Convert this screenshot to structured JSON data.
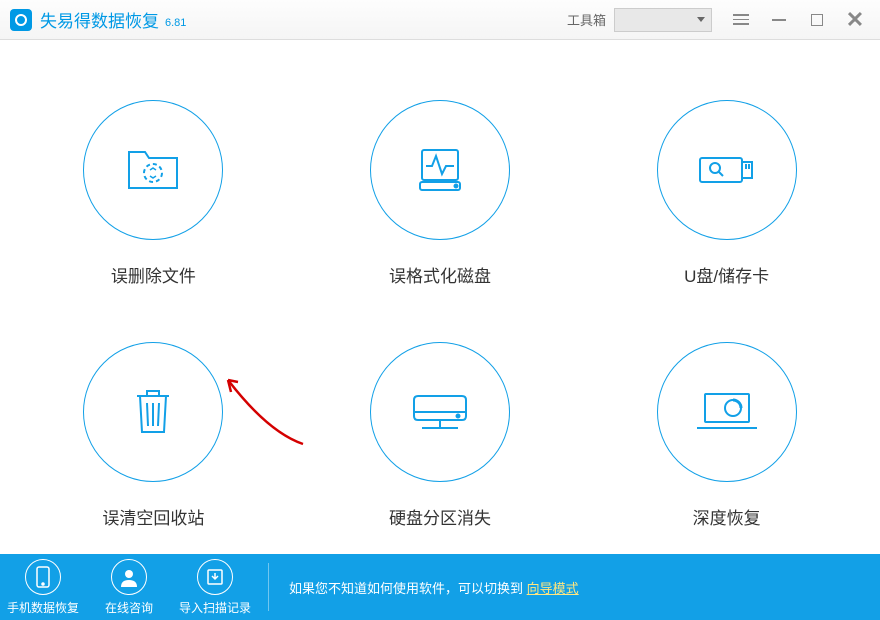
{
  "app": {
    "title": "失易得数据恢复",
    "version": "6.81"
  },
  "toolbar": {
    "toolbox_label": "工具箱"
  },
  "options": [
    {
      "label": "误删除文件"
    },
    {
      "label": "误格式化磁盘"
    },
    {
      "label": "U盘/储存卡"
    },
    {
      "label": "误清空回收站"
    },
    {
      "label": "硬盘分区消失"
    },
    {
      "label": "深度恢复"
    }
  ],
  "footer": {
    "buttons": [
      {
        "label": "手机数据恢复"
      },
      {
        "label": "在线咨询"
      },
      {
        "label": "导入扫描记录"
      }
    ],
    "hint_text": "如果您不知道如何使用软件，可以切换到 ",
    "hint_link": "向导模式"
  }
}
